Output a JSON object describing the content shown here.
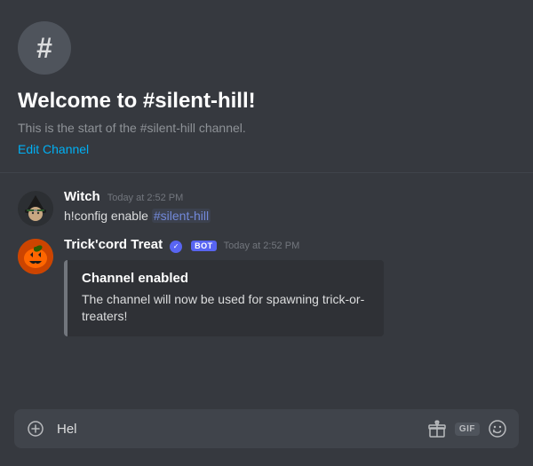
{
  "channel": {
    "name": "silent-hill",
    "welcome_title": "Welcome to #silent-hill!",
    "welcome_desc": "This is the start of the #silent-hill channel.",
    "edit_link": "Edit Channel",
    "hash_symbol": "#"
  },
  "messages": [
    {
      "id": "msg-1",
      "username": "Witch",
      "timestamp": "Today at 2:52 PM",
      "is_bot": false,
      "text_parts": [
        {
          "type": "text",
          "value": "h!config enable "
        },
        {
          "type": "mention",
          "value": "#silent-hill"
        }
      ],
      "embed": null
    },
    {
      "id": "msg-2",
      "username": "Trick'cord Treat",
      "timestamp": "Today at 2:52 PM",
      "is_bot": true,
      "text_parts": [],
      "embed": {
        "title": "Channel enabled",
        "description": "The channel will now be used for spawning trick-or-treaters!"
      }
    }
  ],
  "input": {
    "placeholder": "Hel",
    "add_icon": "+",
    "gift_icon": "🎁",
    "gif_label": "GIF",
    "emoji_icon": "😢"
  }
}
